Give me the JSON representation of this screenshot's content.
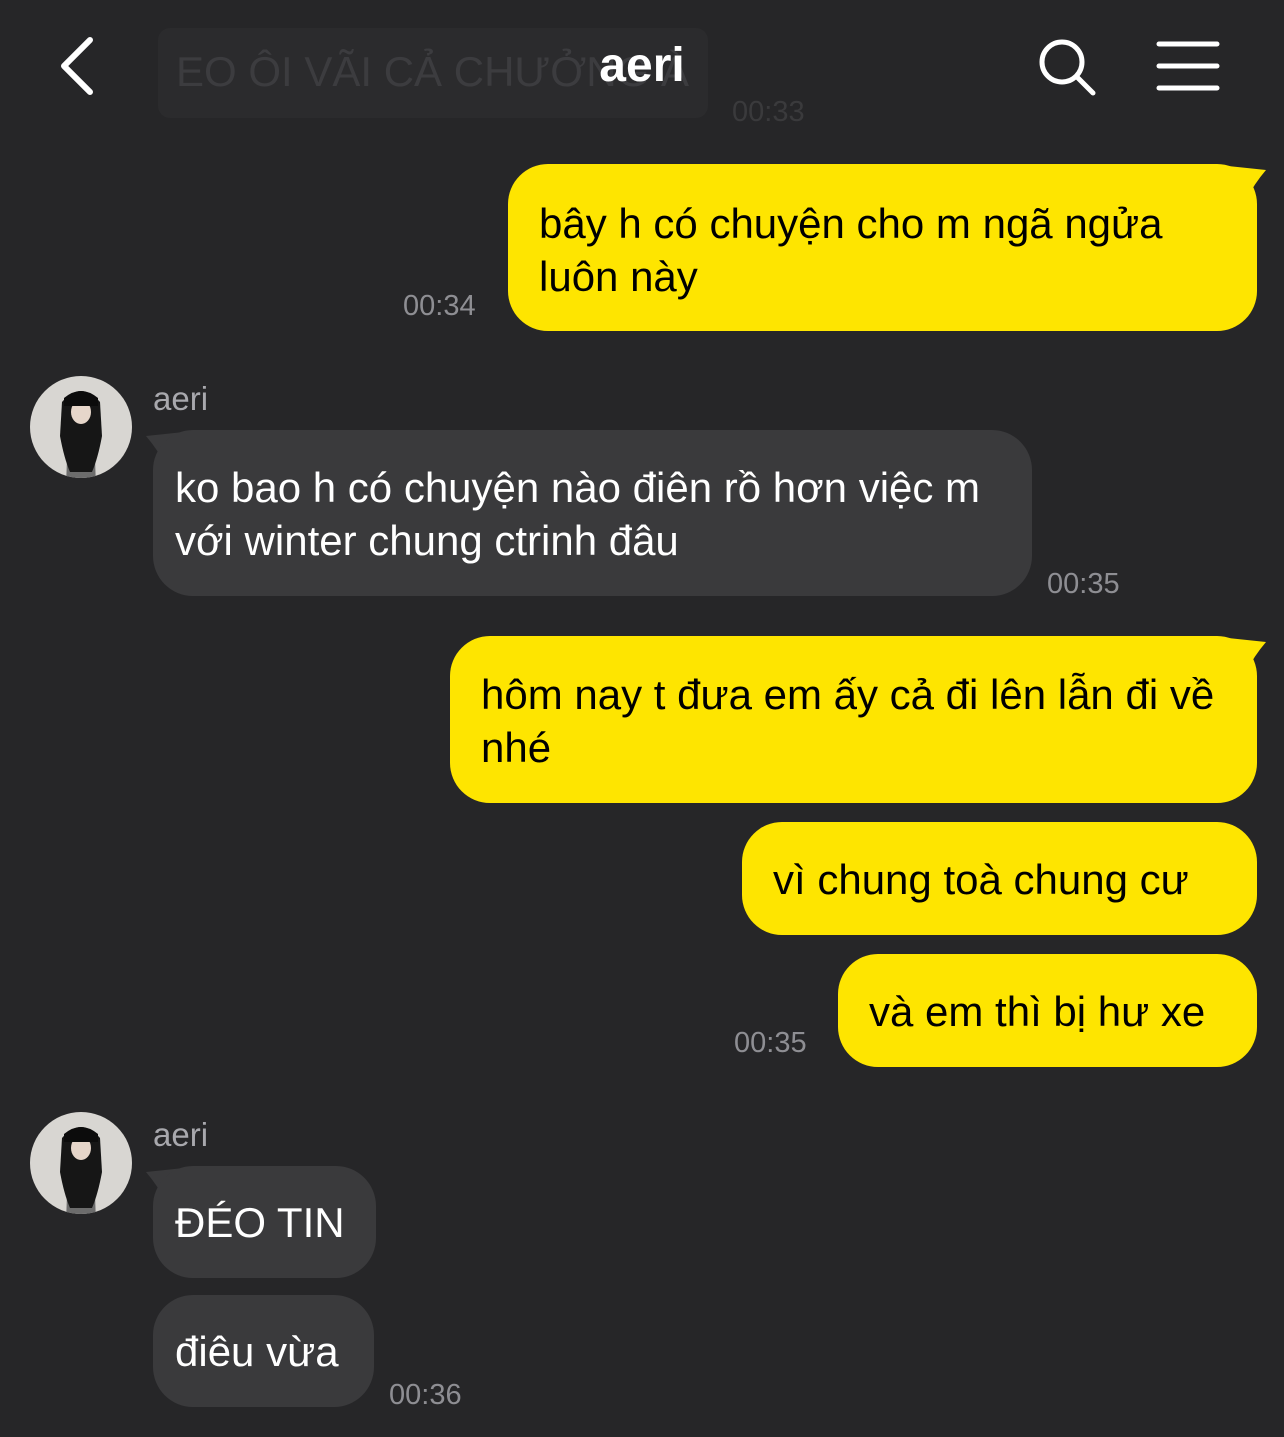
{
  "header": {
    "title": "aeri",
    "faded_previous_message": "EO ÔI VÃI CẢ CHƯỞNG À",
    "faded_previous_time": "00:33",
    "back_icon": "chevron-left-icon",
    "search_icon": "search-icon",
    "menu_icon": "hamburger-menu-icon"
  },
  "colors": {
    "background": "#262628",
    "my_bubble": "#fee500",
    "their_bubble": "#3a3a3c",
    "timestamp": "#8e8e93"
  },
  "messages": [
    {
      "from": "me",
      "text": "bây h có chuyện cho m ngã ngửa luôn này",
      "time": "00:34"
    },
    {
      "from": "them",
      "sender": "aeri",
      "text": "ko bao h có chuyện nào điên rồ hơn việc m với winter chung ctrinh đâu",
      "time": "00:35"
    },
    {
      "from": "me",
      "text": "hôm nay t đưa em ấy cả đi lên lẫn đi về nhé"
    },
    {
      "from": "me",
      "text": "vì chung toà chung cư"
    },
    {
      "from": "me",
      "text": "và em thì bị hư xe",
      "time": "00:35"
    },
    {
      "from": "them",
      "sender": "aeri",
      "text": "ĐÉO TIN"
    },
    {
      "from": "them",
      "text": "điêu vừa",
      "time": "00:36"
    }
  ]
}
